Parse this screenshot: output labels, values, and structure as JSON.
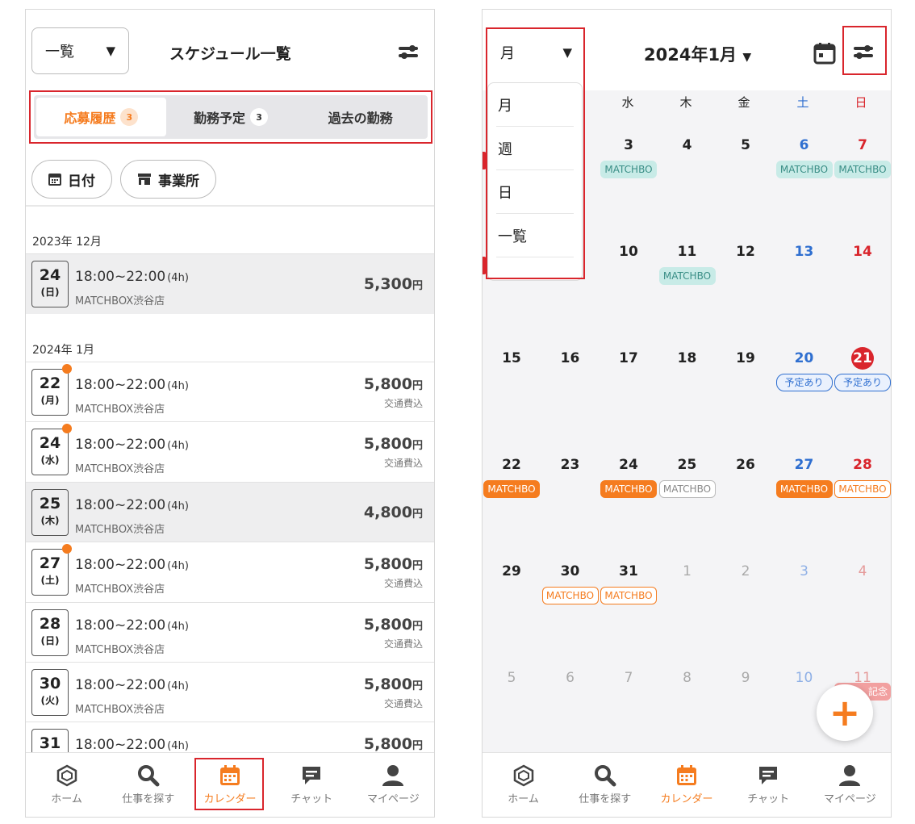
{
  "left": {
    "header": {
      "view_select": "一覧",
      "title": "スケジュール一覧"
    },
    "tabs": [
      {
        "label": "応募履歴",
        "badge": "3"
      },
      {
        "label": "勤務予定",
        "badge": "3"
      },
      {
        "label": "過去の勤務",
        "badge": ""
      }
    ],
    "filters": {
      "date_label": "日付",
      "office_label": "事業所"
    },
    "months": [
      "2023年 12月",
      "2024年 1月"
    ],
    "rows": [
      {
        "day": "24",
        "wday": "(日)",
        "time": "18:00~22:00",
        "dur": "(4h)",
        "shop": "MATCHBOX渋谷店",
        "price": "5,300",
        "yen": "円",
        "transport": ""
      },
      {
        "day": "22",
        "wday": "(月)",
        "time": "18:00~22:00",
        "dur": "(4h)",
        "shop": "MATCHBOX渋谷店",
        "price": "5,800",
        "yen": "円",
        "transport": "交通費込"
      },
      {
        "day": "24",
        "wday": "(水)",
        "time": "18:00~22:00",
        "dur": "(4h)",
        "shop": "MATCHBOX渋谷店",
        "price": "5,800",
        "yen": "円",
        "transport": "交通費込"
      },
      {
        "day": "25",
        "wday": "(木)",
        "time": "18:00~22:00",
        "dur": "(4h)",
        "shop": "MATCHBOX渋谷店",
        "price": "4,800",
        "yen": "円",
        "transport": ""
      },
      {
        "day": "27",
        "wday": "(土)",
        "time": "18:00~22:00",
        "dur": "(4h)",
        "shop": "MATCHBOX渋谷店",
        "price": "5,800",
        "yen": "円",
        "transport": "交通費込"
      },
      {
        "day": "28",
        "wday": "(日)",
        "time": "18:00~22:00",
        "dur": "(4h)",
        "shop": "MATCHBOX渋谷店",
        "price": "5,800",
        "yen": "円",
        "transport": "交通費込"
      },
      {
        "day": "30",
        "wday": "(火)",
        "time": "18:00~22:00",
        "dur": "(4h)",
        "shop": "MATCHBOX渋谷店",
        "price": "5,800",
        "yen": "円",
        "transport": "交通費込"
      },
      {
        "day": "31",
        "wday": "",
        "time": "18:00~22:00",
        "dur": "(4h)",
        "shop": "",
        "price": "5,800",
        "yen": "円",
        "transport": ""
      }
    ]
  },
  "right": {
    "header": {
      "view_select": "月",
      "month_title": "2024年1月"
    },
    "menu": [
      "月",
      "週",
      "日",
      "一覧"
    ],
    "weekdays": [
      "水",
      "木",
      "金",
      "土",
      "日"
    ],
    "week1": [
      "3",
      "4",
      "5",
      "6",
      "7"
    ],
    "week2": [
      "10",
      "11",
      "12",
      "13",
      "14"
    ],
    "week3": [
      "15",
      "16",
      "17",
      "18",
      "19",
      "20",
      "21"
    ],
    "week4": [
      "22",
      "23",
      "24",
      "25",
      "26",
      "27",
      "28"
    ],
    "week5": [
      "29",
      "30",
      "31",
      "1",
      "2",
      "3",
      "4"
    ],
    "week6": [
      "5",
      "6",
      "7",
      "8",
      "9",
      "10",
      "11"
    ],
    "events": {
      "shop": "MATCHBO",
      "planned": "予定あり",
      "holiday": "記念"
    },
    "fab": "+"
  },
  "nav": [
    "ホーム",
    "仕事を探す",
    "カレンダー",
    "チャット",
    "マイページ"
  ],
  "colors": {
    "accent": "#f57c1f",
    "highlight": "#d9252c",
    "teal": "#c8ebe7",
    "saturday": "#2f6fd0",
    "sunday": "#d9252c"
  }
}
